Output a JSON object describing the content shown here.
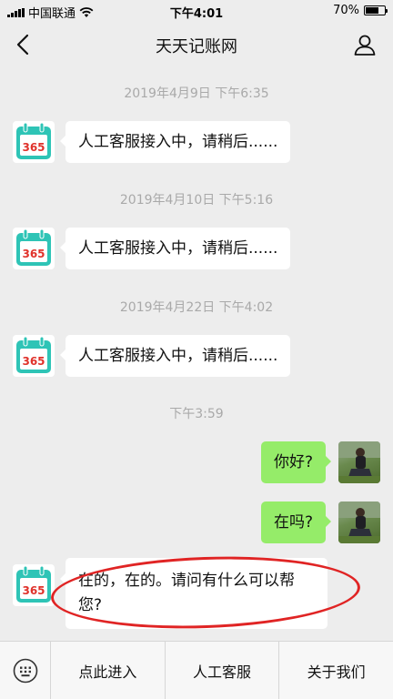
{
  "status_bar": {
    "carrier": "中国联通",
    "time": "下午4:01",
    "battery": "70%",
    "battery_level": 0.7
  },
  "nav": {
    "title": "天天记账网",
    "back_icon": "chevron-left-icon",
    "profile_icon": "person-icon"
  },
  "app_avatar": {
    "text": "365",
    "accent": "#2ec4b6",
    "text_color": "#e0322b"
  },
  "messages": [
    {
      "type": "time",
      "text": "2019年4月9日 下午6:35"
    },
    {
      "type": "in",
      "text": "人工客服接入中，请稍后......"
    },
    {
      "type": "time",
      "text": "2019年4月10日 下午5:16"
    },
    {
      "type": "in",
      "text": "人工客服接入中，请稍后......"
    },
    {
      "type": "time",
      "text": "2019年4月22日 下午4:02"
    },
    {
      "type": "in",
      "text": "人工客服接入中，请稍后......"
    },
    {
      "type": "time",
      "text": "下午3:59"
    },
    {
      "type": "out",
      "text": "你好?"
    },
    {
      "type": "out",
      "text": "在吗?"
    },
    {
      "type": "in",
      "text": "在的，在的。请问有什么可以帮您?"
    }
  ],
  "menu": {
    "keyboard_icon": "keyboard-icon",
    "items": [
      "点此进入",
      "人工客服",
      "关于我们"
    ]
  },
  "colors": {
    "outgoing_bubble": "#95ec69",
    "incoming_bubble": "#ffffff",
    "background": "#ededed",
    "highlight": "#e02424"
  }
}
